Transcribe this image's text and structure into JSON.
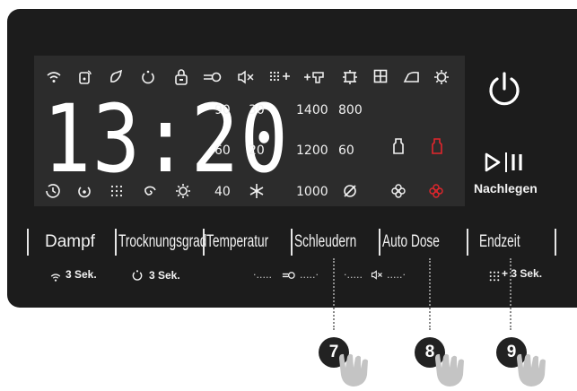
{
  "clock": {
    "time": "13:20"
  },
  "status_icons": [
    "wifi-icon",
    "remote-start-icon",
    "drum-clean-icon",
    "dry-icon",
    "child-lock-icon",
    "key-icon",
    "mute-icon",
    "extra-options-icon",
    "steam-icon",
    "cold-wash-icon",
    "grid-icon",
    "iron-icon",
    "settings-icon"
  ],
  "temperatures": {
    "col1": [
      "90",
      "60",
      "40"
    ],
    "col2": [
      "30",
      "20",
      "*"
    ]
  },
  "spin": {
    "col1": [
      "1400",
      "1200",
      "1000"
    ],
    "col2": [
      "800",
      "60",
      "Ø"
    ]
  },
  "power": {
    "symbol": "⏻"
  },
  "start_pause": {
    "symbol": "▷|‖",
    "label": "Nachlegen"
  },
  "buttons": {
    "dampf": "Dampf",
    "trocknungsgrad": "Trocknungsgrad",
    "temperatur": "Temperatur",
    "schleudern": "Schleudern",
    "auto_dose": "Auto Dose",
    "endzeit": "Endzeit"
  },
  "hints": {
    "dampf": "3 Sek.",
    "trocknungsgrad": "3 Sek.",
    "endzeit": "+ 3 Sek."
  },
  "callouts": [
    "7",
    "8",
    "9"
  ],
  "colors": {
    "accent_red": "#e3262c",
    "panel": "#1c1c1c",
    "display": "#2c2c2c"
  }
}
